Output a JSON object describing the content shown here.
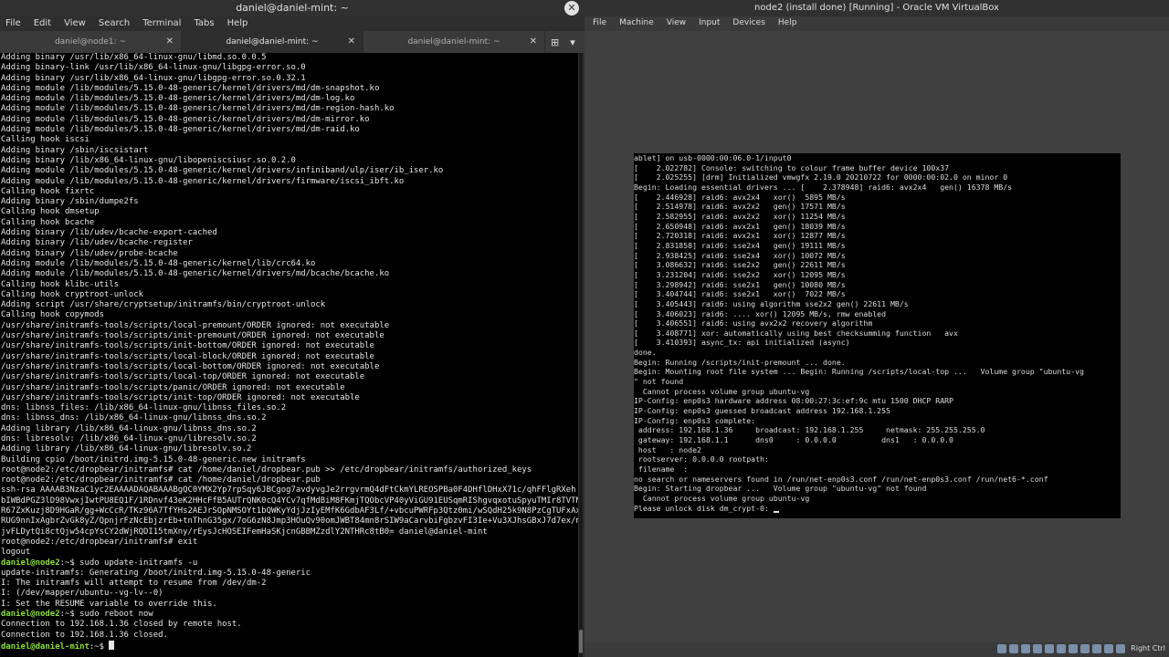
{
  "terminal": {
    "title": "daniel@daniel-mint: ~",
    "menu": [
      "File",
      "Edit",
      "View",
      "Search",
      "Terminal",
      "Tabs",
      "Help"
    ],
    "tabs": [
      {
        "label": "daniel@node1: ~"
      },
      {
        "label": "daniel@daniel-mint: ~"
      },
      {
        "label": "daniel@daniel-mint: ~"
      }
    ],
    "lines_top": "Adding binary /usr/lib/x86_64-linux-gnu/libmd.so.0.0.5\nAdding binary-link /usr/lib/x86_64-linux-gnu/libgpg-error.so.0\nAdding binary /usr/lib/x86_64-linux-gnu/libgpg-error.so.0.32.1\nAdding module /lib/modules/5.15.0-48-generic/kernel/drivers/md/dm-snapshot.ko\nAdding module /lib/modules/5.15.0-48-generic/kernel/drivers/md/dm-log.ko\nAdding module /lib/modules/5.15.0-48-generic/kernel/drivers/md/dm-region-hash.ko\nAdding module /lib/modules/5.15.0-48-generic/kernel/drivers/md/dm-mirror.ko\nAdding module /lib/modules/5.15.0-48-generic/kernel/drivers/md/dm-raid.ko\nCalling hook iscsi\nAdding binary /sbin/iscsistart\nAdding binary /lib/x86_64-linux-gnu/libopeniscsiusr.so.0.2.0\nAdding module /lib/modules/5.15.0-48-generic/kernel/drivers/infiniband/ulp/iser/ib_iser.ko\nAdding module /lib/modules/5.15.0-48-generic/kernel/drivers/firmware/iscsi_ibft.ko\nCalling hook fixrtc\nAdding binary /sbin/dumpe2fs\nCalling hook dmsetup\nCalling hook bcache\nAdding binary /lib/udev/bcache-export-cached\nAdding binary /lib/udev/bcache-register\nAdding binary /lib/udev/probe-bcache\nAdding module /lib/modules/5.15.0-48-generic/kernel/lib/crc64.ko\nAdding module /lib/modules/5.15.0-48-generic/kernel/drivers/md/bcache/bcache.ko\nCalling hook klibc-utils\nCalling hook cryptroot-unlock\nAdding script /usr/share/cryptsetup/initramfs/bin/cryptroot-unlock\nCalling hook copymods\n/usr/share/initramfs-tools/scripts/local-premount/ORDER ignored: not executable\n/usr/share/initramfs-tools/scripts/init-premount/ORDER ignored: not executable\n/usr/share/initramfs-tools/scripts/init-bottom/ORDER ignored: not executable\n/usr/share/initramfs-tools/scripts/local-block/ORDER ignored: not executable\n/usr/share/initramfs-tools/scripts/local-bottom/ORDER ignored: not executable\n/usr/share/initramfs-tools/scripts/local-top/ORDER ignored: not executable\n/usr/share/initramfs-tools/scripts/panic/ORDER ignored: not executable\n/usr/share/initramfs-tools/scripts/init-top/ORDER ignored: not executable\ndns: libnss_files: /lib/x86_64-linux-gnu/libnss_files.so.2\ndns: libnss_dns: /lib/x86_64-linux-gnu/libnss_dns.so.2\nAdding library /lib/x86_64-linux-gnu/libnss_dns.so.2\ndns: libresolv: /lib/x86_64-linux-gnu/libresolv.so.2\nAdding library /lib/x86_64-linux-gnu/libresolv.so.2\nBuilding cpio /boot/initrd.img-5.15.0-48-generic.new initramfs\nroot@node2:/etc/dropbear/initramfs# cat /home/daniel/dropbear.pub >> /etc/dropbear/initramfs/authorized_keys\nroot@node2:/etc/dropbear/initramfs# cat /home/daniel/dropbear.pub\nssh-rsa AAAAB3NzaC1yc2EAAAADAQABAAABgQC0YMX2Yp7rpSqy6JBCgog7avdyvgJe2rrgvrmQ4dFtCkmYLREOSPBa0F4DHflDHxX71c/qhFFlgRXeh\nbIWBdPGZ3lD98VwxjIwtPU8EQ1F/1RDnvf43eK2HHcFfB5AUTrQNK0cQ4YCv7qfMdBiM8FKmjTQObcVP40yViGU91EUSqmRIShgvqxotuSpyuTMIr8TVTN\nR67ZxKuzj8D9HGaR/gg+WcCcR/TKz96A7TfYHs2AEJrSOpNMSOYt1bQWKyYdjJzIyEMfK6GdbAF3Lf/+vbcuPWRFp3Qtz0mi/wSQdH25k9N8PzCgTUFxAx\nRUG9nnIxAgbrZvGk8yZ/QpnjrFzNcEbjzrEb+tnThnG35gx/7oG6zN8Jmp3HOuQv90omJWBT84mn8rSIW9aCarvbiFgbzvFI3Ie+Vu3XJhsGBxJ7d7ex/m\njvFLDytQi8ctQjw54cpYsCY2dWjRQDI15tmXny/rEysJcHOSEIFemHaSKjcnGBBMZzdlY2NTHRc8tB0= daniel@daniel-mint\nroot@node2:/etc/dropbear/initramfs# exit\nlogout",
    "prompt_node2": "daniel@node2",
    "cmd_update": ":~$ sudo update-initramfs -u",
    "lines_update": "update-initramfs: Generating /boot/initrd.img-5.15.0-48-generic\nI: The initramfs will attempt to resume from /dev/dm-2\nI: (/dev/mapper/ubuntu--vg-lv--0)\nI: Set the RESUME variable to override this.",
    "cmd_reboot": ":~$ sudo reboot now",
    "lines_reboot": "Connection to 192.168.1.36 closed by remote host.\nConnection to 192.168.1.36 closed.",
    "prompt_mint": "daniel@daniel-mint",
    "prompt_mint_suffix": ":~$ "
  },
  "vbox": {
    "title": "node2 (install done) [Running] - Oracle VM VirtualBox",
    "menu": [
      "File",
      "Machine",
      "View",
      "Input",
      "Devices",
      "Help"
    ],
    "console": "ablet] on usb-0000:00:06.0-1/input0\n[    2.022782] Console: switching to colour frame buffer device 100x37\n[    2.025255] [drm] Initialized vmwgfx 2.19.0 20210722 for 0000:00:02.0 on minor 0\nBegin: Loading essential drivers ... [    2.378948] raid6: avx2x4   gen() 16378 MB/s\n[    2.446928] raid6: avx2x4   xor()  5895 MB/s\n[    2.514978] raid6: avx2x2   gen() 17571 MB/s\n[    2.582955] raid6: avx2x2   xor() 11254 MB/s\n[    2.650948] raid6: avx2x1   gen() 18039 MB/s\n[    2.720318] raid6: avx2x1   xor() 12877 MB/s\n[    2.831858] raid6: sse2x4   gen() 19111 MB/s\n[    2.938425] raid6: sse2x4   xor() 10072 MB/s\n[    3.086632] raid6: sse2x2   gen() 22611 MB/s\n[    3.231204] raid6: sse2x2   xor() 12095 MB/s\n[    3.298942] raid6: sse2x1   gen() 10080 MB/s\n[    3.404744] raid6: sse2x1   xor()  7022 MB/s\n[    3.405443] raid6: using algorithm sse2x2 gen() 22611 MB/s\n[    3.406023] raid6: .... xor() 12095 MB/s, rmw enabled\n[    3.406551] raid6: using avx2x2 recovery algorithm\n[    3.408771] xor: automatically using best checksumming function   avx\n[    3.410393] async_tx: api initialized (async)\ndone.\nBegin: Running /scripts/init-premount ... done.\nBegin: Mounting root file system ... Begin: Running /scripts/local-top ...   Volume group \"ubuntu-vg\n\" not found\n  Cannot process volume group ubuntu-vg\nIP-Config: enp0s3 hardware address 08:00:27:3c:ef:9c mtu 1500 DHCP RARP\nIP-Config: enp0s3 guessed broadcast address 192.168.1.255\nIP-Config: enp0s3 complete:\n address: 192.168.1.36     broadcast: 192.168.1.255     netmask: 255.255.255.0\n gateway: 192.168.1.1      dns0     : 0.0.0.0          dns1   : 0.0.0.0\n host   : node2\n rootserver: 0.0.0.0 rootpath:\n filename  :\nno search or nameservers found in /run/net-enp0s3.conf /run/net-enp0s3.conf /run/net6-*.conf\nBegin: Starting dropbear ...   Volume group \"ubuntu-vg\" not found\n  Cannot process volume group ubuntu-vg\nPlease unlock disk dm_crypt-0: ",
    "hostkey": "Right Ctrl"
  }
}
